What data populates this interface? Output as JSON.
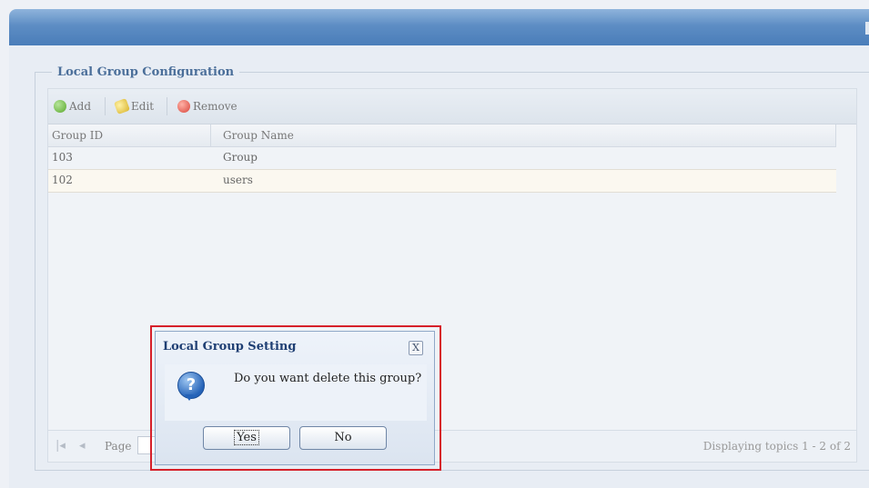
{
  "section_title": "Local Group Configuration",
  "toolbar": {
    "add_label": "Add",
    "edit_label": "Edit",
    "remove_label": "Remove"
  },
  "table": {
    "columns": [
      "Group ID",
      "Group Name"
    ],
    "rows": [
      {
        "group_id": "103",
        "group_name": "Group"
      },
      {
        "group_id": "102",
        "group_name": "users"
      }
    ]
  },
  "pager": {
    "first_icon": "first-page-icon",
    "prev_icon": "prev-page-icon",
    "page_label": "Page",
    "displaying": "Displaying topics 1 - 2 of 2"
  },
  "dialog": {
    "title": "Local Group Setting",
    "close_glyph": "X",
    "message": "Do you want delete this group?",
    "icon": "question-icon",
    "icon_glyph": "?",
    "yes_label": "Yes",
    "no_label": "No"
  },
  "colors": {
    "titlebar": "#5d8dc4",
    "highlight": "#d6202a",
    "dialog_title": "#1f3f73"
  }
}
